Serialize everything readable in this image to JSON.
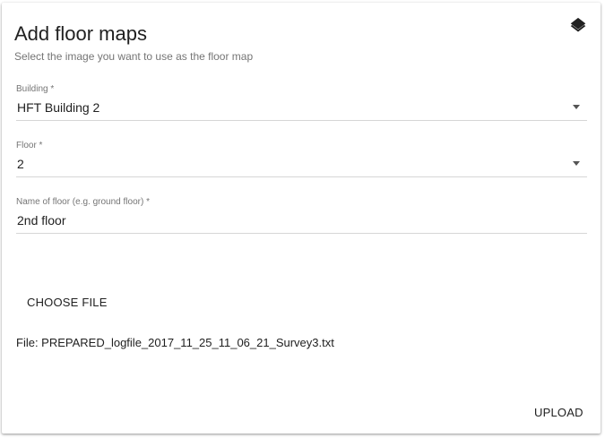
{
  "dialog": {
    "title": "Add floor maps",
    "subtitle": "Select the image you want to use as the floor map",
    "icon": "layers-icon"
  },
  "fields": {
    "building": {
      "label": "Building *",
      "value": "HFT Building 2"
    },
    "floor": {
      "label": "Floor *",
      "value": "2"
    },
    "floor_name": {
      "label": "Name of floor (e.g. ground floor) *",
      "value": "2nd floor"
    }
  },
  "actions": {
    "choose_file_label": "CHOOSE FILE",
    "upload_label": "UPLOAD"
  },
  "file": {
    "text": "File: PREPARED_logfile_2017_11_25_11_06_21_Survey3.txt"
  },
  "colors": {
    "text": "#212121",
    "secondary_text": "#757575",
    "divider": "#d6d6d6"
  }
}
